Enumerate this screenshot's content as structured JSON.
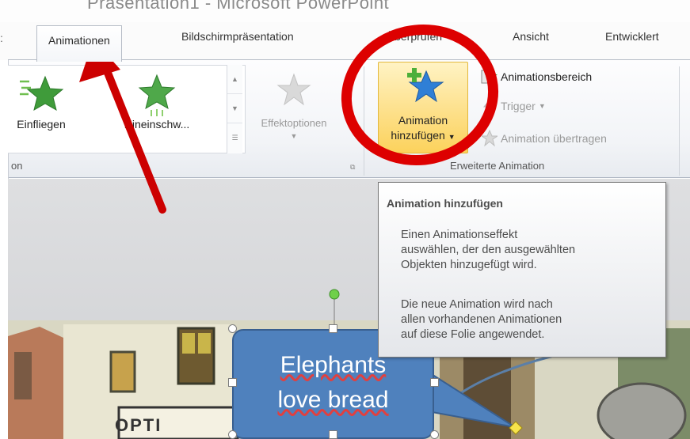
{
  "window": {
    "title": "Präsentation1 - Microsoft PowerPoint"
  },
  "tabs": [
    {
      "label": "Animationen"
    },
    {
      "label": "Bildschirmpräsentation"
    },
    {
      "label": "Überprüfen"
    },
    {
      "label": "Ansicht"
    },
    {
      "label": "Entwicklert"
    }
  ],
  "ribbon": {
    "gallery": {
      "items": [
        {
          "label": "Einfliegen",
          "icon": "fly-in-star-icon"
        },
        {
          "label": "Hineinschw...",
          "icon": "swivel-in-star-icon"
        }
      ]
    },
    "effect_options": {
      "label": "Effektoptionen"
    },
    "animation_group_label": "on",
    "add_animation": {
      "line1": "Animation",
      "line2": "hinzufügen",
      "icon": "star-plus-icon"
    },
    "advanced": {
      "animation_pane": "Animationsbereich",
      "trigger": "Trigger",
      "painter": "Animation übertragen",
      "group_label": "Erweiterte Animation"
    }
  },
  "tooltip": {
    "title": "Animation hinzufügen",
    "para1": "Einen Animationseffekt\nauswählen, der den ausgewählten\nObjekten hinzugefügt wird.",
    "para2": "Die neue Animation wird nach\nallen vorhandenen Animationen\nauf diese Folie angewendet."
  },
  "slide": {
    "callout_line1": "Elephants",
    "callout_line2": "love bread",
    "sign_text": "OPTI"
  },
  "annotation_colors": {
    "circle": "#dd0000",
    "arrow": "#cc0000"
  }
}
